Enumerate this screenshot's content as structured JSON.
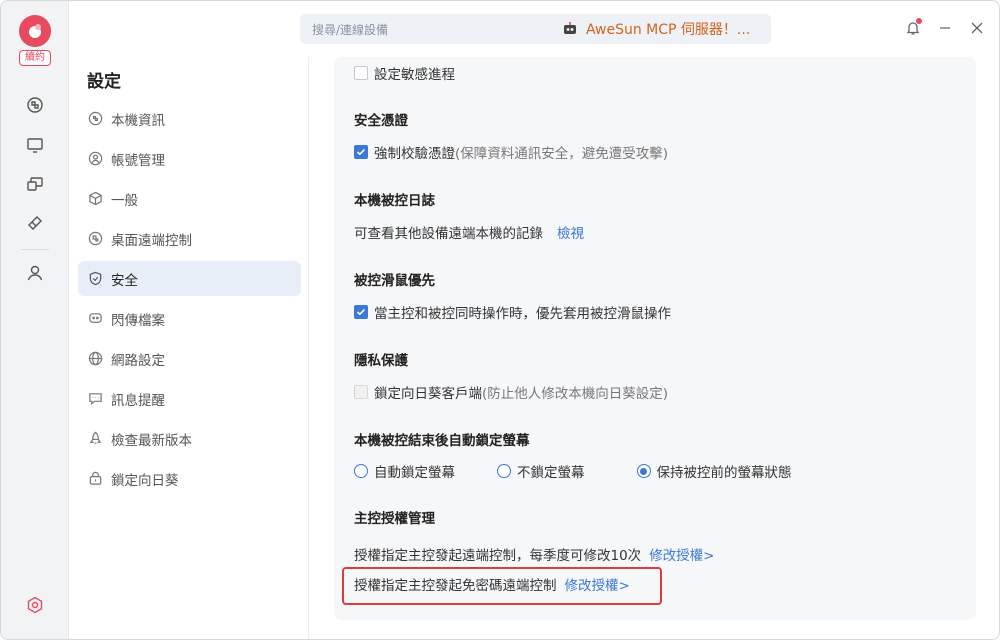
{
  "rail": {
    "renew_badge": "續約",
    "items": [
      "remote-control-icon",
      "monitor-icon",
      "devices-icon",
      "tools-icon",
      "user-icon"
    ],
    "bottom_icon": "settings-hex-icon"
  },
  "topbar": {
    "search_placeholder": "搜尋/連線設備",
    "promo_text": "AweSun MCP 伺服器！..."
  },
  "nav": {
    "title": "設定",
    "items": [
      {
        "label": "本機資訊",
        "icon": "info-icon"
      },
      {
        "label": "帳號管理",
        "icon": "account-icon"
      },
      {
        "label": "一般",
        "icon": "cube-icon"
      },
      {
        "label": "桌面遠端控制",
        "icon": "remote-icon"
      },
      {
        "label": "安全",
        "icon": "shield-icon",
        "active": true
      },
      {
        "label": "閃傳檔案",
        "icon": "chat-icon"
      },
      {
        "label": "網路設定",
        "icon": "globe-icon"
      },
      {
        "label": "訊息提醒",
        "icon": "message-icon"
      },
      {
        "label": "檢查最新版本",
        "icon": "rocket-icon"
      },
      {
        "label": "鎖定向日葵",
        "icon": "lock-icon"
      }
    ]
  },
  "content": {
    "sensitive_process": {
      "label": "設定敏感進程",
      "checked": false
    },
    "security_cert": {
      "title": "安全憑證",
      "option_label": "強制校驗憑證",
      "option_note": "(保障資料通訊安全，避免遭受攻擊)",
      "checked": true
    },
    "controlled_log": {
      "title": "本機被控日誌",
      "text": "可查看其他設備遠端本機的記錄",
      "link": "檢視"
    },
    "mouse_priority": {
      "title": "被控滑鼠優先",
      "option_label": "當主控和被控同時操作時，優先套用被控滑鼠操作",
      "checked": true
    },
    "privacy": {
      "title": "隱私保護",
      "option_label": "鎖定向日葵客戶端",
      "option_note": "(防止他人修改本機向日葵設定)",
      "checked": false
    },
    "auto_lock": {
      "title": "本機被控結束後自動鎖定螢幕",
      "options": [
        "自動鎖定螢幕",
        "不鎖定螢幕",
        "保持被控前的螢幕狀態"
      ],
      "selected_index": 2
    },
    "master_auth": {
      "title": "主控授權管理",
      "row1_text": "授權指定主控發起遠端控制，每季度可修改10次",
      "row1_link": "修改授權>",
      "row2_text": "授權指定主控發起免密碼遠端控制",
      "row2_link": "修改授權>"
    }
  },
  "colors": {
    "accent": "#3b78d8",
    "brand": "#e84a5f",
    "promo": "#d4621c",
    "highlight": "#e0393e"
  }
}
